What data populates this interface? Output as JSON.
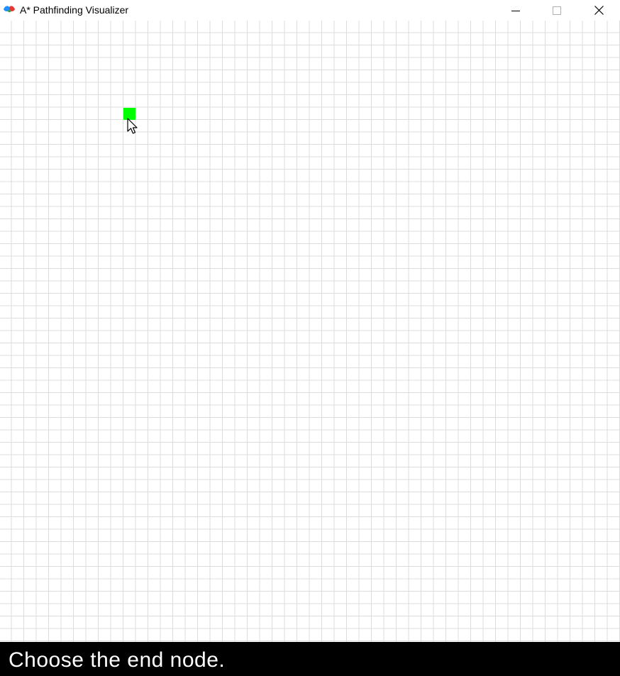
{
  "window": {
    "title": "A* Pathfinding Visualizer",
    "icon": "pygame-snake-icon",
    "controls": [
      "minimize",
      "maximize",
      "close"
    ]
  },
  "grid": {
    "line_color": "#dcdcdc",
    "background": "#ffffff",
    "start_node_color": "#00ff00"
  },
  "status": {
    "message": "Choose the end node.",
    "background": "#000000",
    "text_color": "#ffffff"
  }
}
